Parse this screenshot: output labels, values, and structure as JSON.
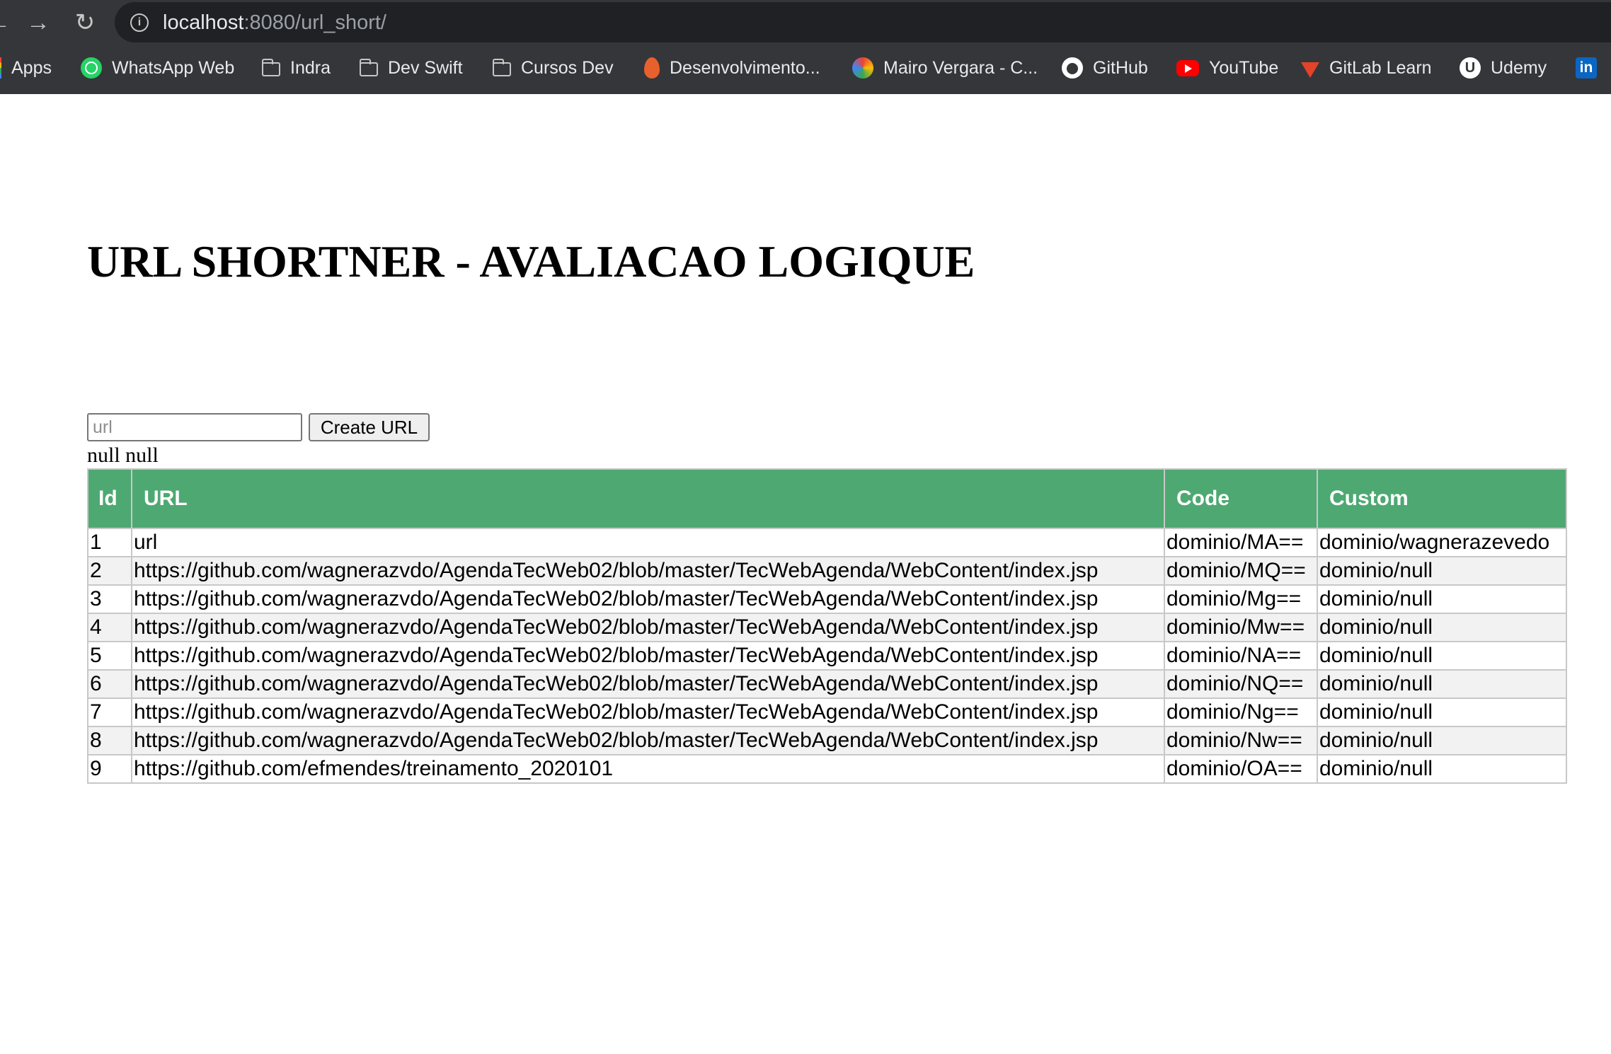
{
  "browser": {
    "url_host": "localhost",
    "url_rest": ":8080/url_short/",
    "bookmarks": [
      {
        "label": "Apps",
        "icon": "apps-icon"
      },
      {
        "label": "WhatsApp Web",
        "icon": "whatsapp-icon"
      },
      {
        "label": "Indra",
        "icon": "folder-icon"
      },
      {
        "label": "Dev Swift",
        "icon": "folder-icon"
      },
      {
        "label": "Cursos Dev",
        "icon": "folder-icon"
      },
      {
        "label": "Desenvolvimento...",
        "icon": "flame-icon"
      },
      {
        "label": "Mairo Vergara - C...",
        "icon": "site-icon"
      },
      {
        "label": "GitHub",
        "icon": "github-icon"
      },
      {
        "label": "YouTube",
        "icon": "youtube-icon"
      },
      {
        "label": "GitLab Learn",
        "icon": "gitlab-icon"
      },
      {
        "label": "Udemy",
        "icon": "udemy-icon"
      },
      {
        "label": "in",
        "icon": "linkedin-icon"
      }
    ]
  },
  "page": {
    "title": "URL SHORTNER - AVALIACAO LOGIQUE",
    "input_placeholder": "url",
    "create_button": "Create URL",
    "null_text": "null null"
  },
  "table": {
    "headers": [
      "Id",
      "URL",
      "Code",
      "Custom"
    ],
    "header_color": "#4ea872",
    "rows": [
      [
        "1",
        "url",
        "dominio/MA==",
        "dominio/wagnerazevedo"
      ],
      [
        "2",
        "https://github.com/wagnerazvdo/AgendaTecWeb02/blob/master/TecWebAgenda/WebContent/index.jsp",
        "dominio/MQ==",
        "dominio/null"
      ],
      [
        "3",
        "https://github.com/wagnerazvdo/AgendaTecWeb02/blob/master/TecWebAgenda/WebContent/index.jsp",
        "dominio/Mg==",
        "dominio/null"
      ],
      [
        "4",
        "https://github.com/wagnerazvdo/AgendaTecWeb02/blob/master/TecWebAgenda/WebContent/index.jsp",
        "dominio/Mw==",
        "dominio/null"
      ],
      [
        "5",
        "https://github.com/wagnerazvdo/AgendaTecWeb02/blob/master/TecWebAgenda/WebContent/index.jsp",
        "dominio/NA==",
        "dominio/null"
      ],
      [
        "6",
        "https://github.com/wagnerazvdo/AgendaTecWeb02/blob/master/TecWebAgenda/WebContent/index.jsp",
        "dominio/NQ==",
        "dominio/null"
      ],
      [
        "7",
        "https://github.com/wagnerazvdo/AgendaTecWeb02/blob/master/TecWebAgenda/WebContent/index.jsp",
        "dominio/Ng==",
        "dominio/null"
      ],
      [
        "8",
        "https://github.com/wagnerazvdo/AgendaTecWeb02/blob/master/TecWebAgenda/WebContent/index.jsp",
        "dominio/Nw==",
        "dominio/null"
      ],
      [
        "9",
        "https://github.com/efmendes/treinamento_2020101",
        "dominio/OA==",
        "dominio/null"
      ]
    ]
  }
}
